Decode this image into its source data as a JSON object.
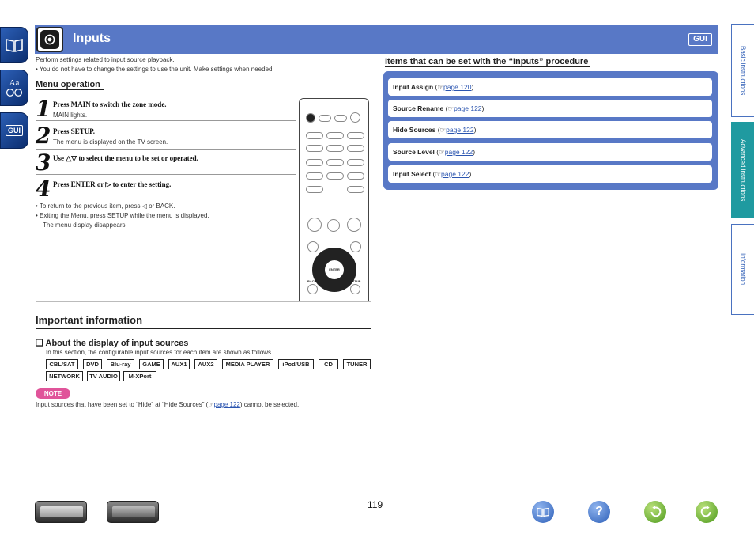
{
  "header": {
    "title": "Inputs",
    "badge": "GUI"
  },
  "left_nav": {
    "text_badge": "Aa",
    "gui_badge": "GUI"
  },
  "intro": {
    "line1": "Perform settings related to input source playback.",
    "line2": "• You do not have to change the settings to use the unit. Make settings when needed."
  },
  "menu_operation": {
    "heading": "Menu operation",
    "steps": [
      {
        "num": "1",
        "text": "Press MAIN to switch the zone mode.",
        "sub": "MAIN lights."
      },
      {
        "num": "2",
        "text": "Press SETUP.",
        "sub": "The menu is displayed on the TV screen."
      },
      {
        "num": "3",
        "text": "Use △▽ to select the menu to be set or operated.",
        "sub": ""
      },
      {
        "num": "4",
        "text": "Press ENTER or ▷ to enter the setting.",
        "sub": ""
      }
    ],
    "bullet1": "• To return to the previous item, press ◁ or BACK.",
    "bullet2": "• Exiting the Menu, press SETUP while the menu is displayed.",
    "bullet3": "The menu display disappears."
  },
  "remote": {
    "enter_label": "ENTER",
    "back_label": "BACK",
    "setup_label": "SETUP"
  },
  "important": {
    "heading": "Important information",
    "about_heading": "❑ About the display of input sources",
    "about_desc": "In this section, the configurable input sources for each item are shown as follows.",
    "tags": [
      "CBL/SAT",
      "DVD",
      "Blu-ray",
      "GAME",
      "AUX1",
      "AUX2",
      "MEDIA PLAYER",
      "iPod/USB",
      "CD",
      "TUNER",
      "NETWORK",
      "TV AUDIO",
      "M-XPort"
    ],
    "note_label": "NOTE",
    "note_pre": "Input sources that have been set to “Hide” at “Hide Sources” (",
    "note_link": "page 122",
    "note_post": ") cannot be selected."
  },
  "items": {
    "heading": "Items that can be set with the “Inputs” procedure",
    "rows": [
      {
        "label": "Input Assign",
        "link": "page 120"
      },
      {
        "label": "Source Rename",
        "link": "page 122"
      },
      {
        "label": "Hide Sources",
        "link": "page 122"
      },
      {
        "label": "Source Level",
        "link": "page 122"
      },
      {
        "label": "Input Select",
        "link": "page 122"
      }
    ]
  },
  "right_tabs": [
    "Basic instructions",
    "Advanced instructions",
    "Information"
  ],
  "footer": {
    "page_number": "119"
  },
  "colors": {
    "header_blue": "#5878c6",
    "active_tab": "#1f9aa0",
    "note_pink": "#e0549a",
    "link_blue": "#2b55b0"
  }
}
